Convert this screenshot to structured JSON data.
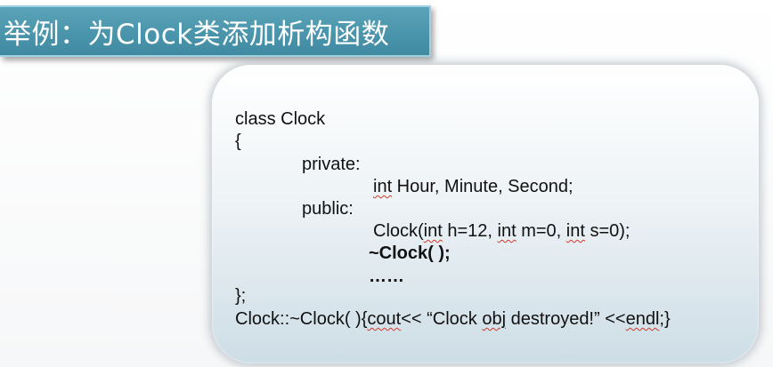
{
  "slide": {
    "title": "举例：为Clock类添加析构函数"
  },
  "code": {
    "line1": "class Clock",
    "line2": "{",
    "line3": "private:",
    "line4_kw": "int",
    "line4_rest": " Hour, Minute, Second;",
    "line5": "public:",
    "line6_a": "Clock(",
    "line6_kw1": "int",
    "line6_b": " h=12, ",
    "line6_kw2": "int",
    "line6_c": " m=0, ",
    "line6_kw3": "int",
    "line6_d": " s=0);",
    "line7": "~Clock( );",
    "line8": "……",
    "line9": "};",
    "line10_a": "Clock::~Clock( ){",
    "line10_kw1": "cout",
    "line10_b": "<<  “Clock ",
    "line10_kw2": "obj",
    "line10_c": " destroyed!”  <<",
    "line10_kw3": "endl",
    "line10_d": ";}"
  },
  "colors": {
    "banner": "#4a96ad",
    "squiggle": "#d23a2a"
  }
}
